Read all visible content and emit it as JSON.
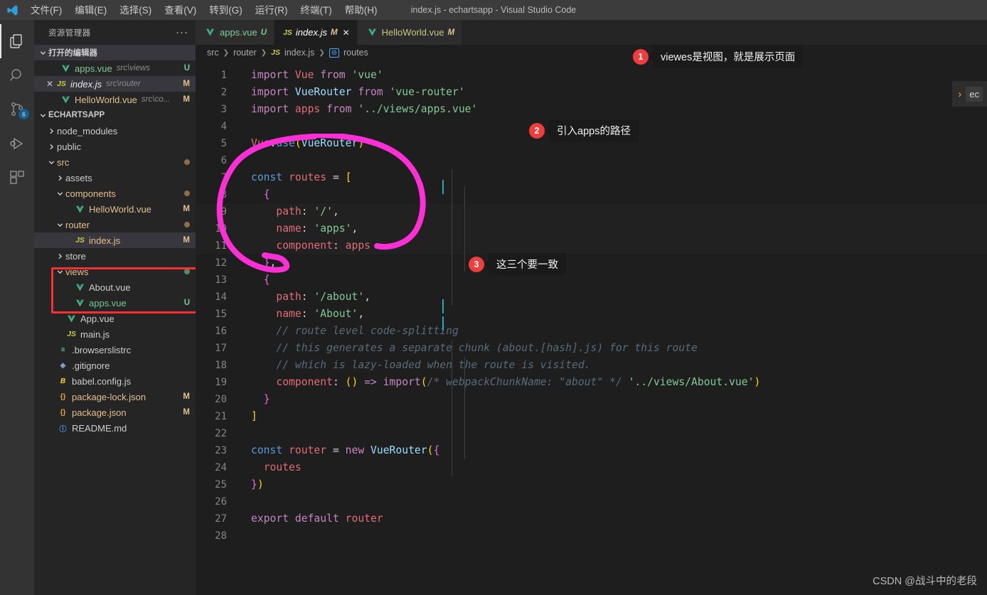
{
  "window": {
    "title": "index.js - echartsapp - Visual Studio Code",
    "logo_icon": "vscode-logo-icon"
  },
  "menubar": {
    "items": [
      {
        "label": "文件(F)",
        "name": "menu-file"
      },
      {
        "label": "编辑(E)",
        "name": "menu-edit"
      },
      {
        "label": "选择(S)",
        "name": "menu-selection"
      },
      {
        "label": "查看(V)",
        "name": "menu-view"
      },
      {
        "label": "转到(G)",
        "name": "menu-go"
      },
      {
        "label": "运行(R)",
        "name": "menu-run"
      },
      {
        "label": "终端(T)",
        "name": "menu-terminal"
      },
      {
        "label": "帮助(H)",
        "name": "menu-help"
      }
    ]
  },
  "activitybar": {
    "items": [
      {
        "icon": "files-explorer-icon",
        "active": true,
        "badge": ""
      },
      {
        "icon": "search-icon",
        "active": false,
        "badge": ""
      },
      {
        "icon": "source-control-icon",
        "active": false,
        "badge": "6"
      },
      {
        "icon": "run-and-debug-icon",
        "active": false,
        "badge": ""
      },
      {
        "icon": "extensions-icon",
        "active": false,
        "badge": ""
      }
    ]
  },
  "sidebar": {
    "title": "资源管理器",
    "more_actions": "···",
    "open_editors": {
      "label": "打开的编辑器",
      "items": [
        {
          "name": "apps.vue",
          "path": "src\\views",
          "status": "U",
          "icon": "vue-file-icon",
          "selected": false,
          "italic": false,
          "show_close": false
        },
        {
          "name": "index.js",
          "path": "src\\router",
          "status": "M",
          "icon": "js-file-icon",
          "selected": true,
          "italic": true,
          "show_close": true
        },
        {
          "name": "HelloWorld.vue",
          "path": "src\\co...",
          "status": "M",
          "icon": "vue-file-icon",
          "selected": false,
          "italic": false,
          "show_close": false
        }
      ]
    },
    "project": {
      "label": "ECHARTSAPP",
      "items": [
        {
          "label": "node_modules",
          "type": "folder",
          "expanded": false,
          "indent": 1,
          "status": "",
          "dot": "",
          "icon": ""
        },
        {
          "label": "public",
          "type": "folder",
          "expanded": false,
          "indent": 1,
          "status": "",
          "dot": "",
          "icon": ""
        },
        {
          "label": "src",
          "type": "folder",
          "expanded": true,
          "indent": 1,
          "status": "",
          "dot": "#8b6d4b",
          "icon": ""
        },
        {
          "label": "assets",
          "type": "folder",
          "expanded": false,
          "indent": 2,
          "status": "",
          "dot": "",
          "icon": ""
        },
        {
          "label": "components",
          "type": "folder",
          "expanded": true,
          "indent": 2,
          "status": "",
          "dot": "#8b6d4b",
          "icon": ""
        },
        {
          "label": "HelloWorld.vue",
          "type": "file",
          "expanded": false,
          "indent": 3,
          "status": "M",
          "dot": "",
          "icon": "vue-file-icon"
        },
        {
          "label": "router",
          "type": "folder",
          "expanded": true,
          "indent": 2,
          "status": "",
          "dot": "#8b6d4b",
          "icon": ""
        },
        {
          "label": "index.js",
          "type": "file",
          "expanded": false,
          "indent": 3,
          "status": "M",
          "dot": "",
          "icon": "js-file-icon",
          "selected": true
        },
        {
          "label": "store",
          "type": "folder",
          "expanded": false,
          "indent": 2,
          "status": "",
          "dot": "",
          "icon": ""
        },
        {
          "label": "views",
          "type": "folder",
          "expanded": true,
          "indent": 2,
          "status": "",
          "dot": "#4e8f5e",
          "icon": ""
        },
        {
          "label": "About.vue",
          "type": "file",
          "expanded": false,
          "indent": 3,
          "status": "",
          "dot": "",
          "icon": "vue-file-icon"
        },
        {
          "label": "apps.vue",
          "type": "file",
          "expanded": false,
          "indent": 3,
          "status": "U",
          "dot": "",
          "icon": "vue-file-icon",
          "untracked": true
        },
        {
          "label": "App.vue",
          "type": "file",
          "expanded": false,
          "indent": 2,
          "status": "",
          "dot": "",
          "icon": "vue-file-icon"
        },
        {
          "label": "main.js",
          "type": "file",
          "expanded": false,
          "indent": 2,
          "status": "",
          "dot": "",
          "icon": "js-file-icon"
        },
        {
          "label": ".browserslistrc",
          "type": "file",
          "expanded": false,
          "indent": 1,
          "status": "",
          "dot": "",
          "icon": "config-file-icon"
        },
        {
          "label": ".gitignore",
          "type": "file",
          "expanded": false,
          "indent": 1,
          "status": "",
          "dot": "",
          "icon": "git-file-icon"
        },
        {
          "label": "babel.config.js",
          "type": "file",
          "expanded": false,
          "indent": 1,
          "status": "",
          "dot": "",
          "icon": "babel-file-icon"
        },
        {
          "label": "package-lock.json",
          "type": "file",
          "expanded": false,
          "indent": 1,
          "status": "M",
          "dot": "",
          "icon": "json-file-icon"
        },
        {
          "label": "package.json",
          "type": "file",
          "expanded": false,
          "indent": 1,
          "status": "M",
          "dot": "",
          "icon": "json-file-icon"
        },
        {
          "label": "README.md",
          "type": "file",
          "expanded": false,
          "indent": 1,
          "status": "",
          "dot": "",
          "icon": "readme-file-icon"
        }
      ]
    },
    "highlight_box": {
      "color": "#fa2f33",
      "covers": "views / About.vue / apps.vue"
    }
  },
  "tabs": [
    {
      "label": "apps.vue",
      "tag": "U",
      "icon": "vue-file-icon",
      "active": false,
      "closable": false,
      "color": "green"
    },
    {
      "label": "index.js",
      "tag": "M",
      "icon": "js-file-icon",
      "active": true,
      "closable": true,
      "color": "white"
    },
    {
      "label": "HelloWorld.vue",
      "tag": "M",
      "icon": "vue-file-icon",
      "active": false,
      "closable": false,
      "color": "gray"
    }
  ],
  "breadcrumb": {
    "parts": [
      "src",
      "router",
      "index.js",
      "routes"
    ],
    "symbol_icon": "variable-symbol-icon",
    "js_icon": "js-file-icon"
  },
  "code": {
    "language": "javascript",
    "first_line": 1,
    "total_lines": 28,
    "lines": [
      {
        "n": 1,
        "text": "import Vue from 'vue'"
      },
      {
        "n": 2,
        "text": "import VueRouter from 'vue-router'"
      },
      {
        "n": 3,
        "text": "import apps from '../views/apps.vue'"
      },
      {
        "n": 4,
        "text": ""
      },
      {
        "n": 5,
        "text": "Vue.use(VueRouter)"
      },
      {
        "n": 6,
        "text": ""
      },
      {
        "n": 7,
        "text": "const routes = ["
      },
      {
        "n": 8,
        "text": "  {"
      },
      {
        "n": 9,
        "text": "    path: '/',"
      },
      {
        "n": 10,
        "text": "    name: 'apps',"
      },
      {
        "n": 11,
        "text": "    component: apps"
      },
      {
        "n": 12,
        "text": "  },"
      },
      {
        "n": 13,
        "text": "  {"
      },
      {
        "n": 14,
        "text": "    path: '/about',"
      },
      {
        "n": 15,
        "text": "    name: 'About',"
      },
      {
        "n": 16,
        "text": "    // route level code-splitting"
      },
      {
        "n": 17,
        "text": "    // this generates a separate chunk (about.[hash].js) for this route"
      },
      {
        "n": 18,
        "text": "    // which is lazy-loaded when the route is visited."
      },
      {
        "n": 19,
        "text": "    component: () => import(/* webpackChunkName: \"about\" */ '../views/About.vue')"
      },
      {
        "n": 20,
        "text": "  }"
      },
      {
        "n": 21,
        "text": "]"
      },
      {
        "n": 22,
        "text": ""
      },
      {
        "n": 23,
        "text": "const router = new VueRouter({"
      },
      {
        "n": 24,
        "text": "  routes"
      },
      {
        "n": 25,
        "text": "})"
      },
      {
        "n": 26,
        "text": ""
      },
      {
        "n": 27,
        "text": "export default router"
      },
      {
        "n": 28,
        "text": ""
      }
    ]
  },
  "annotations": [
    {
      "number": "1",
      "text": "viewes是视图，就是展示页面"
    },
    {
      "number": "2",
      "text": "引入apps的路径"
    },
    {
      "number": "3",
      "text": "这三个要一致"
    }
  ],
  "ink_circle": {
    "color": "#ff2fd6",
    "shape": "hand-drawn-ellipse"
  },
  "right_peek": {
    "text": "ec",
    "chevron": "›"
  },
  "watermark": {
    "text": "CSDN @战斗中的老段"
  }
}
